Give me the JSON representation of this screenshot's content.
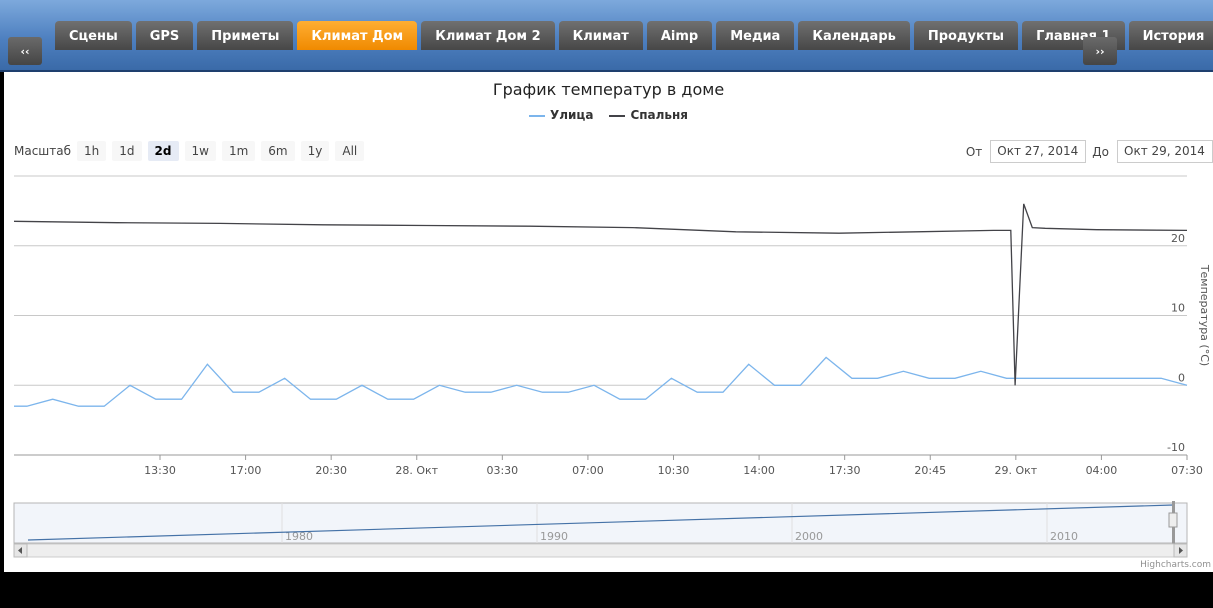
{
  "nav": {
    "prev_label": "‹‹",
    "next_label": "››",
    "tabs": [
      {
        "label": "Сцены",
        "active": false
      },
      {
        "label": "GPS",
        "active": false
      },
      {
        "label": "Приметы",
        "active": false
      },
      {
        "label": "Климат Дом",
        "active": true
      },
      {
        "label": "Климат Дом 2",
        "active": false
      },
      {
        "label": "Климат",
        "active": false
      },
      {
        "label": "Aimp",
        "active": false
      },
      {
        "label": "Медиа",
        "active": false
      },
      {
        "label": "Календарь",
        "active": false
      },
      {
        "label": "Продукты",
        "active": false
      },
      {
        "label": "Главная 1",
        "active": false
      },
      {
        "label": "История",
        "active": false
      }
    ],
    "accent": "#f59a1f"
  },
  "range": {
    "label": "Масштаб",
    "buttons": [
      "1h",
      "1d",
      "2d",
      "1w",
      "1m",
      "6m",
      "1y",
      "All"
    ],
    "selected": "2d",
    "from_label": "От",
    "from_value": "Окт 27, 2014",
    "to_label": "До",
    "to_value": "Окт 29, 2014"
  },
  "credit": "Highcharts.com",
  "chart_data": {
    "type": "line",
    "title": "График температур в доме",
    "ylabel": "Температура (°C)",
    "ylim": [
      -10,
      30
    ],
    "yticks": [
      -10,
      0,
      10,
      20
    ],
    "grid": true,
    "legend_position": "top-center",
    "x_ticks": [
      "13:30",
      "17:00",
      "20:30",
      "28. Окт",
      "03:30",
      "07:00",
      "10:30",
      "14:00",
      "17:30",
      "20:45",
      "29. Окт",
      "04:00",
      "07:30"
    ],
    "x_start": "2014-10-27 10:00",
    "x_end": "2014-10-29 07:30",
    "series": [
      {
        "name": "Улица",
        "color": "#7cb5ec",
        "points": [
          [
            "2014-10-27 10:00",
            -3
          ],
          [
            "2014-10-27 10:30",
            -3
          ],
          [
            "2014-10-27 11:30",
            -2
          ],
          [
            "2014-10-27 12:30",
            -3
          ],
          [
            "2014-10-27 13:30",
            -3
          ],
          [
            "2014-10-27 14:30",
            0
          ],
          [
            "2014-10-27 15:30",
            -2
          ],
          [
            "2014-10-27 16:30",
            -2
          ],
          [
            "2014-10-27 17:30",
            3
          ],
          [
            "2014-10-27 18:30",
            -1
          ],
          [
            "2014-10-27 19:30",
            -1
          ],
          [
            "2014-10-27 20:30",
            1
          ],
          [
            "2014-10-27 21:30",
            -2
          ],
          [
            "2014-10-27 22:30",
            -2
          ],
          [
            "2014-10-27 23:30",
            0
          ],
          [
            "2014-10-28 00:30",
            -2
          ],
          [
            "2014-10-28 01:30",
            -2
          ],
          [
            "2014-10-28 02:30",
            0
          ],
          [
            "2014-10-28 03:30",
            -1
          ],
          [
            "2014-10-28 04:30",
            -1
          ],
          [
            "2014-10-28 05:30",
            0
          ],
          [
            "2014-10-28 06:30",
            -1
          ],
          [
            "2014-10-28 07:30",
            -1
          ],
          [
            "2014-10-28 08:30",
            0
          ],
          [
            "2014-10-28 09:30",
            -2
          ],
          [
            "2014-10-28 10:30",
            -2
          ],
          [
            "2014-10-28 11:30",
            1
          ],
          [
            "2014-10-28 12:30",
            -1
          ],
          [
            "2014-10-28 13:30",
            -1
          ],
          [
            "2014-10-28 14:30",
            3
          ],
          [
            "2014-10-28 15:30",
            0
          ],
          [
            "2014-10-28 16:30",
            0
          ],
          [
            "2014-10-28 17:30",
            4
          ],
          [
            "2014-10-28 18:30",
            1
          ],
          [
            "2014-10-28 19:30",
            1
          ],
          [
            "2014-10-28 20:30",
            2
          ],
          [
            "2014-10-28 21:30",
            1
          ],
          [
            "2014-10-28 22:30",
            1
          ],
          [
            "2014-10-28 23:30",
            2
          ],
          [
            "2014-10-29 00:30",
            1
          ],
          [
            "2014-10-29 01:30",
            1
          ],
          [
            "2014-10-29 03:30",
            1
          ],
          [
            "2014-10-29 05:30",
            1
          ],
          [
            "2014-10-29 06:30",
            1
          ],
          [
            "2014-10-29 07:30",
            0
          ]
        ]
      },
      {
        "name": "Спальня",
        "color": "#434348",
        "points": [
          [
            "2014-10-27 10:00",
            23.5
          ],
          [
            "2014-10-27 14:00",
            23.3
          ],
          [
            "2014-10-27 18:00",
            23.2
          ],
          [
            "2014-10-27 22:00",
            23
          ],
          [
            "2014-10-28 02:00",
            22.9
          ],
          [
            "2014-10-28 06:00",
            22.8
          ],
          [
            "2014-10-28 10:00",
            22.6
          ],
          [
            "2014-10-28 14:00",
            22
          ],
          [
            "2014-10-28 18:00",
            21.8
          ],
          [
            "2014-10-28 21:00",
            22
          ],
          [
            "2014-10-29 00:00",
            22.2
          ],
          [
            "2014-10-29 00:40",
            22.2
          ],
          [
            "2014-10-29 00:50",
            0
          ],
          [
            "2014-10-29 01:10",
            26
          ],
          [
            "2014-10-29 01:30",
            22.6
          ],
          [
            "2014-10-29 02:00",
            22.5
          ],
          [
            "2014-10-29 04:00",
            22.3
          ],
          [
            "2014-10-29 07:30",
            22.2
          ]
        ]
      }
    ],
    "navigator": {
      "x_labels": [
        "1980",
        "1990",
        "2000",
        "2010"
      ],
      "series_start": 0.3,
      "series_end": 0.97
    }
  }
}
